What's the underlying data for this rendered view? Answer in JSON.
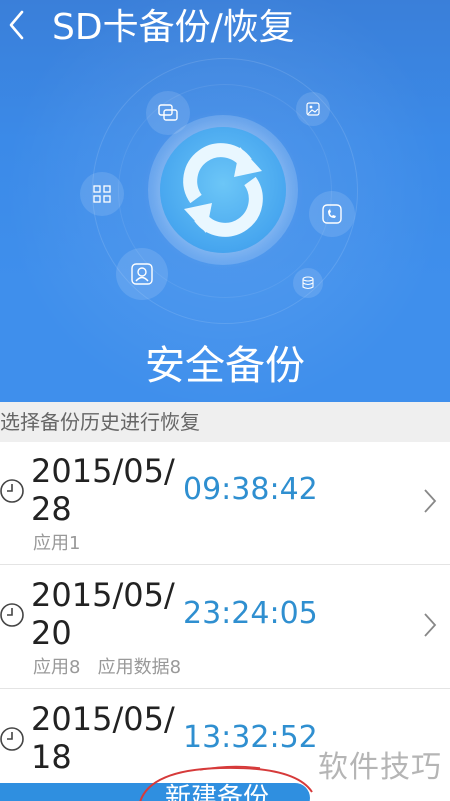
{
  "header": {
    "back_icon": "chevron-left-icon",
    "title": "SD卡备份/恢复"
  },
  "hero": {
    "center_icon": "sync-icon",
    "satellite_icons": [
      "chat-icon",
      "image-icon",
      "grid-icon",
      "phone-icon",
      "contact-icon",
      "database-icon"
    ],
    "label": "安全备份"
  },
  "section": {
    "title": "选择备份历史进行恢复"
  },
  "backups": [
    {
      "date": "2015/05/28",
      "time": "09:38:42",
      "meta": "应用1"
    },
    {
      "date": "2015/05/20",
      "time": "23:24:05",
      "meta": "应用8   应用数据8"
    },
    {
      "date": "2015/05/18",
      "time": "13:32:52",
      "meta": ""
    }
  ],
  "footer": {
    "new_backup_label": "新建备份"
  },
  "watermark": "软件技巧",
  "colors": {
    "hero_blue": "#3b8ae8",
    "time_blue": "#2f8fd0",
    "button_blue": "#2f8fe0",
    "annotation_red": "#d63a3a"
  }
}
